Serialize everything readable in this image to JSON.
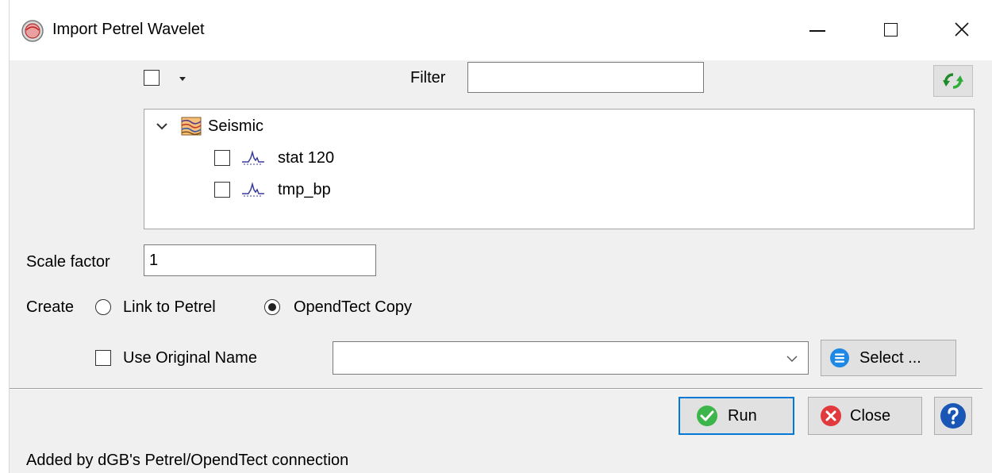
{
  "window": {
    "title": "Import Petrel Wavelet",
    "minimize_icon": "minimize-icon",
    "maximize_icon": "maximize-icon",
    "close_icon": "close-icon"
  },
  "toolbar": {
    "filter_label": "Filter",
    "filter_value": "",
    "refresh_icon": "refresh-icon"
  },
  "tree": {
    "root": {
      "label": "Seismic",
      "expanded": true,
      "icon": "seismic-icon"
    },
    "items": [
      {
        "label": "stat 120",
        "checked": false,
        "icon": "wavelet-icon"
      },
      {
        "label": "tmp_bp",
        "checked": false,
        "icon": "wavelet-icon"
      }
    ]
  },
  "scale": {
    "label": "Scale factor",
    "value": "1"
  },
  "create": {
    "label": "Create",
    "options": [
      {
        "label": "Link to Petrel",
        "selected": false
      },
      {
        "label": "OpendTect Copy",
        "selected": true
      }
    ]
  },
  "output": {
    "use_original_label": "Use Original Name",
    "use_original_checked": false,
    "name_value": "",
    "select_label": "Select ..."
  },
  "buttons": {
    "run_label": "Run",
    "close_label": "Close",
    "help_icon": "help-icon"
  },
  "status": {
    "text": "Added by dGB's Petrel/OpendTect connection"
  },
  "colors": {
    "accent": "#0078d7",
    "run_green": "#3cb54a",
    "close_red": "#e0393e",
    "help_blue": "#1a56b5"
  }
}
